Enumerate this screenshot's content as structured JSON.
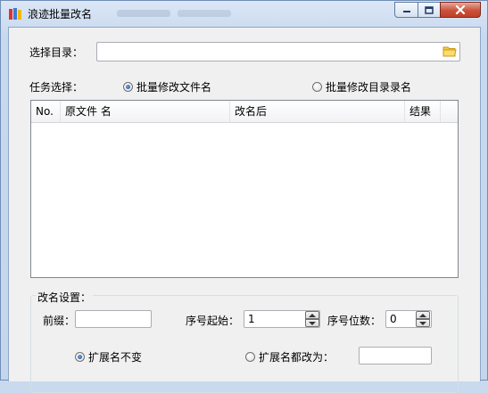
{
  "window": {
    "title": "浪迹批量改名"
  },
  "directory": {
    "label": "选择目录：",
    "value": ""
  },
  "task": {
    "label": "任务选择：",
    "options": [
      {
        "label": "批量修改文件名",
        "selected": true
      },
      {
        "label": "批量修改目录录名",
        "selected": false
      }
    ]
  },
  "list": {
    "columns": [
      "No.",
      "原文件 名",
      "改名后",
      "结果"
    ],
    "rows": []
  },
  "rename": {
    "group_label": "改名设置：",
    "prefix_label": "前缀：",
    "prefix_value": "",
    "start_label": "序号起始：",
    "start_value": "1",
    "digits_label": "序号位数：",
    "digits_value": "0",
    "ext_options": [
      {
        "label": "扩展名不变",
        "selected": true
      },
      {
        "label": "扩展名都改为：",
        "selected": false
      }
    ],
    "ext_value": ""
  },
  "colors": {
    "accent": "#1b4d9a",
    "close": "#c33e25",
    "frame": "#c8d8ee"
  },
  "icons": [
    "app-icon",
    "minimize-icon",
    "maximize-icon",
    "close-icon",
    "folder-icon"
  ]
}
